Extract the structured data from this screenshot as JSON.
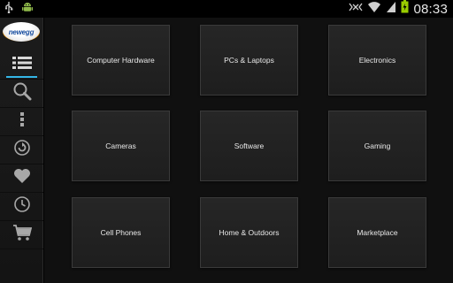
{
  "status_bar": {
    "time": "08:33",
    "left_icons": [
      "usb-icon",
      "android-debug-icon"
    ],
    "right_icons": [
      "signal-mute-icon",
      "wifi-icon",
      "cell-signal-icon",
      "battery-charging-icon"
    ]
  },
  "sidebar": {
    "logo": "newegg",
    "items": [
      {
        "icon": "list-icon",
        "active": true
      },
      {
        "icon": "search-icon",
        "active": false
      },
      {
        "icon": "more-vertical-icon",
        "active": false
      },
      {
        "icon": "refresh-circle-icon",
        "active": false
      },
      {
        "icon": "heart-icon",
        "active": false
      },
      {
        "icon": "clock-icon",
        "active": false
      },
      {
        "icon": "cart-icon",
        "active": false
      }
    ]
  },
  "categories": [
    {
      "label": "Computer Hardware"
    },
    {
      "label": "PCs & Laptops"
    },
    {
      "label": "Electronics"
    },
    {
      "label": "Cameras"
    },
    {
      "label": "Software"
    },
    {
      "label": "Gaming"
    },
    {
      "label": "Cell Phones"
    },
    {
      "label": "Home & Outdoors"
    },
    {
      "label": "Marketplace"
    }
  ],
  "colors": {
    "accent": "#33b5e5",
    "battery": "#99cc00"
  }
}
